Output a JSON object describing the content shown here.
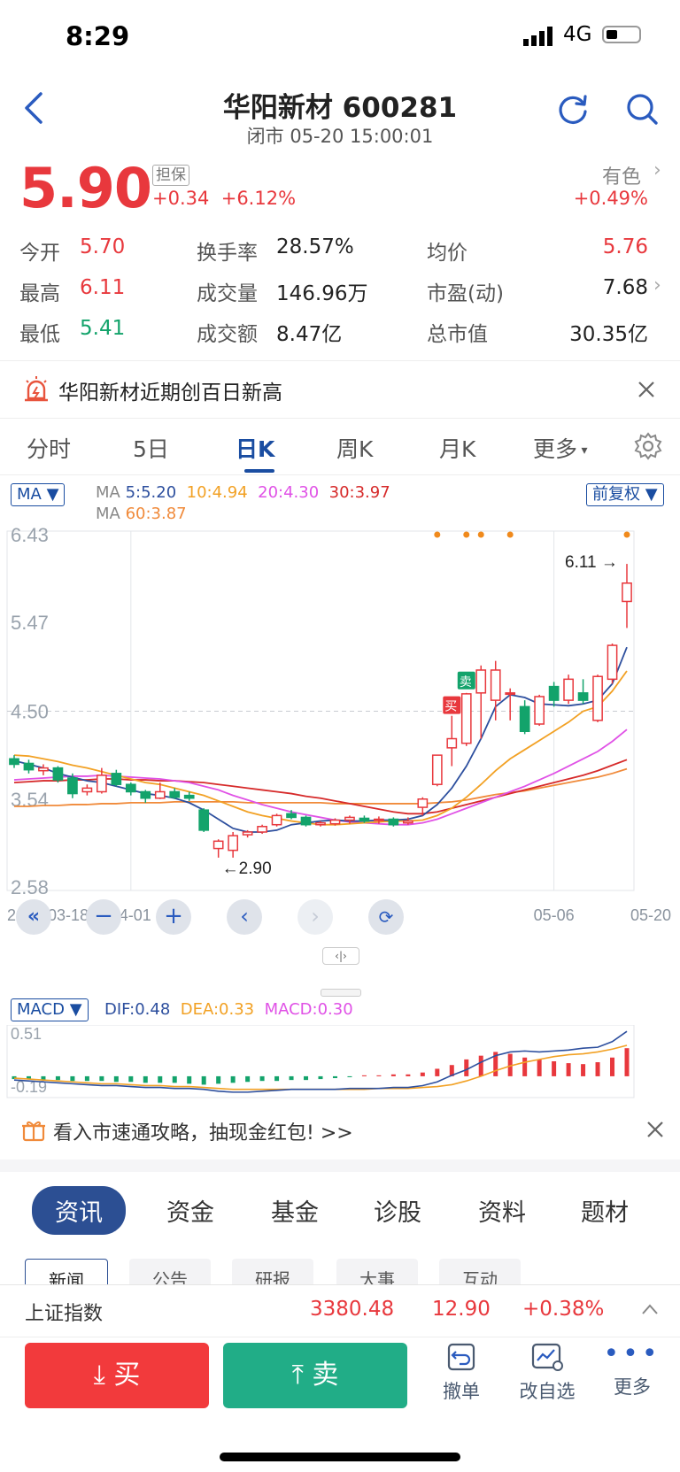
{
  "status_bar": {
    "time": "8:29",
    "network": "4G"
  },
  "header": {
    "title": "华阳新材 600281",
    "subtitle": "闭市 05-20 15:00:01"
  },
  "quote": {
    "price": "5.90",
    "tag": "担保",
    "change": "+0.34",
    "change_pct": "+6.12%",
    "sector": "有色",
    "sector_pct": "+0.49%"
  },
  "stats": [
    {
      "label": "今开",
      "value": "5.70",
      "color": "#e8383d"
    },
    {
      "label": "换手率",
      "value": "28.57%",
      "color": "#222222"
    },
    {
      "label": "均价",
      "value": "5.76",
      "color": "#e8383d"
    },
    {
      "label": "最高",
      "value": "6.11",
      "color": "#e8383d"
    },
    {
      "label": "成交量",
      "value": "146.96万",
      "color": "#222222"
    },
    {
      "label": "市盈(动)",
      "value": "7.68",
      "color": "#222222"
    },
    {
      "label": "最低",
      "value": "5.41",
      "color": "#13a36b"
    },
    {
      "label": "成交额",
      "value": "8.47亿",
      "color": "#222222"
    },
    {
      "label": "总市值",
      "value": "30.35亿",
      "color": "#222222"
    }
  ],
  "notice": {
    "text": "华阳新材近期创百日新高"
  },
  "kline_tabs": [
    "分时",
    "5日",
    "日K",
    "周K",
    "月K",
    "更多"
  ],
  "kline_active": "日K",
  "ma_legend": {
    "selector": "MA",
    "prefix": "MA",
    "ma5": "5:5.20",
    "ma10": "10:4.94",
    "ma20": "20:4.30",
    "ma30": "30:3.97",
    "ma60": "60:3.87",
    "adjust": "前复权"
  },
  "colors": {
    "ma5": "#2d4f9e",
    "ma10": "#f2a124",
    "ma20": "#e052e6",
    "ma30": "#d62a2a",
    "ma60": "#f08a3a",
    "up": "#e8383d",
    "down": "#13a36b"
  },
  "chart_data": {
    "type": "candlestick",
    "y_ticks": [
      "6.43",
      "5.47",
      "4.50",
      "3.54",
      "2.58"
    ],
    "x_ticks": [
      "2025-03-18",
      "04-01",
      "05-06",
      "05-20"
    ],
    "ylim": [
      2.58,
      6.43
    ],
    "high_marker": "6.11",
    "low_marker": "2.90",
    "buy_label": "买",
    "sell_label": "卖",
    "candles": [
      {
        "o": 3.98,
        "h": 4.02,
        "l": 3.88,
        "c": 3.92
      },
      {
        "o": 3.93,
        "h": 3.97,
        "l": 3.82,
        "c": 3.86
      },
      {
        "o": 3.85,
        "h": 3.92,
        "l": 3.8,
        "c": 3.88
      },
      {
        "o": 3.88,
        "h": 3.9,
        "l": 3.72,
        "c": 3.75
      },
      {
        "o": 3.77,
        "h": 3.82,
        "l": 3.55,
        "c": 3.6
      },
      {
        "o": 3.62,
        "h": 3.7,
        "l": 3.58,
        "c": 3.66
      },
      {
        "o": 3.62,
        "h": 3.88,
        "l": 3.6,
        "c": 3.8
      },
      {
        "o": 3.82,
        "h": 3.86,
        "l": 3.68,
        "c": 3.7
      },
      {
        "o": 3.7,
        "h": 3.72,
        "l": 3.58,
        "c": 3.62
      },
      {
        "o": 3.62,
        "h": 3.64,
        "l": 3.5,
        "c": 3.55
      },
      {
        "o": 3.55,
        "h": 3.72,
        "l": 3.54,
        "c": 3.62
      },
      {
        "o": 3.62,
        "h": 3.66,
        "l": 3.54,
        "c": 3.56
      },
      {
        "o": 3.58,
        "h": 3.62,
        "l": 3.52,
        "c": 3.55
      },
      {
        "o": 3.42,
        "h": 3.44,
        "l": 3.18,
        "c": 3.2
      },
      {
        "o": 3.0,
        "h": 3.1,
        "l": 2.9,
        "c": 3.08
      },
      {
        "o": 2.98,
        "h": 3.18,
        "l": 2.9,
        "c": 3.14
      },
      {
        "o": 3.15,
        "h": 3.2,
        "l": 3.12,
        "c": 3.18
      },
      {
        "o": 3.18,
        "h": 3.26,
        "l": 3.16,
        "c": 3.24
      },
      {
        "o": 3.26,
        "h": 3.38,
        "l": 3.24,
        "c": 3.36
      },
      {
        "o": 3.38,
        "h": 3.42,
        "l": 3.32,
        "c": 3.34
      },
      {
        "o": 3.34,
        "h": 3.36,
        "l": 3.24,
        "c": 3.26
      },
      {
        "o": 3.26,
        "h": 3.3,
        "l": 3.24,
        "c": 3.28
      },
      {
        "o": 3.27,
        "h": 3.33,
        "l": 3.25,
        "c": 3.31
      },
      {
        "o": 3.31,
        "h": 3.36,
        "l": 3.27,
        "c": 3.34
      },
      {
        "o": 3.33,
        "h": 3.36,
        "l": 3.28,
        "c": 3.3
      },
      {
        "o": 3.31,
        "h": 3.35,
        "l": 3.27,
        "c": 3.32
      },
      {
        "o": 3.32,
        "h": 3.34,
        "l": 3.24,
        "c": 3.26
      },
      {
        "o": 3.28,
        "h": 3.34,
        "l": 3.26,
        "c": 3.3
      },
      {
        "o": 3.45,
        "h": 3.56,
        "l": 3.36,
        "c": 3.54
      },
      {
        "o": 3.7,
        "h": 4.02,
        "l": 3.68,
        "c": 4.02
      },
      {
        "o": 4.1,
        "h": 4.45,
        "l": 3.9,
        "c": 4.2
      },
      {
        "o": 4.15,
        "h": 4.7,
        "l": 4.12,
        "c": 4.69
      },
      {
        "o": 4.7,
        "h": 5.0,
        "l": 4.2,
        "c": 4.95
      },
      {
        "o": 4.62,
        "h": 5.05,
        "l": 4.4,
        "c": 4.95
      },
      {
        "o": 4.7,
        "h": 4.75,
        "l": 4.4,
        "c": 4.7
      },
      {
        "o": 4.55,
        "h": 4.62,
        "l": 4.25,
        "c": 4.28
      },
      {
        "o": 4.36,
        "h": 4.68,
        "l": 4.34,
        "c": 4.66
      },
      {
        "o": 4.77,
        "h": 4.82,
        "l": 4.55,
        "c": 4.62
      },
      {
        "o": 4.62,
        "h": 4.9,
        "l": 4.58,
        "c": 4.85
      },
      {
        "o": 4.7,
        "h": 4.85,
        "l": 4.58,
        "c": 4.62
      },
      {
        "o": 4.4,
        "h": 4.9,
        "l": 4.38,
        "c": 4.88
      },
      {
        "o": 4.85,
        "h": 5.24,
        "l": 4.8,
        "c": 5.22
      },
      {
        "o": 5.7,
        "h": 6.11,
        "l": 5.41,
        "c": 5.9
      }
    ],
    "ma5": [
      3.96,
      3.92,
      3.88,
      3.82,
      3.78,
      3.74,
      3.72,
      3.68,
      3.64,
      3.6,
      3.58,
      3.55,
      3.5,
      3.42,
      3.32,
      3.22,
      3.18,
      3.18,
      3.2,
      3.26,
      3.28,
      3.3,
      3.31,
      3.3,
      3.3,
      3.31,
      3.31,
      3.32,
      3.36,
      3.48,
      3.66,
      3.9,
      4.2,
      4.55,
      4.68,
      4.65,
      4.58,
      4.57,
      4.56,
      4.58,
      4.62,
      4.8,
      5.2
    ],
    "ma10": [
      4.02,
      4.01,
      3.98,
      3.95,
      3.91,
      3.88,
      3.84,
      3.8,
      3.76,
      3.72,
      3.7,
      3.66,
      3.62,
      3.58,
      3.52,
      3.46,
      3.4,
      3.36,
      3.33,
      3.3,
      3.28,
      3.26,
      3.26,
      3.27,
      3.28,
      3.29,
      3.3,
      3.3,
      3.31,
      3.36,
      3.44,
      3.56,
      3.7,
      3.85,
      3.98,
      4.08,
      4.18,
      4.28,
      4.38,
      4.5,
      4.55,
      4.72,
      4.94
    ],
    "ma20": [
      3.75,
      3.76,
      3.77,
      3.78,
      3.79,
      3.79,
      3.8,
      3.79,
      3.78,
      3.77,
      3.76,
      3.74,
      3.72,
      3.68,
      3.64,
      3.58,
      3.53,
      3.48,
      3.44,
      3.4,
      3.37,
      3.34,
      3.31,
      3.29,
      3.28,
      3.27,
      3.26,
      3.26,
      3.28,
      3.32,
      3.38,
      3.44,
      3.5,
      3.56,
      3.62,
      3.68,
      3.75,
      3.82,
      3.9,
      3.98,
      4.06,
      4.17,
      4.3
    ],
    "ma30": [
      3.72,
      3.73,
      3.74,
      3.74,
      3.75,
      3.75,
      3.76,
      3.76,
      3.75,
      3.75,
      3.74,
      3.74,
      3.73,
      3.72,
      3.7,
      3.68,
      3.66,
      3.64,
      3.62,
      3.6,
      3.57,
      3.55,
      3.52,
      3.49,
      3.46,
      3.43,
      3.4,
      3.38,
      3.38,
      3.4,
      3.44,
      3.48,
      3.52,
      3.56,
      3.6,
      3.64,
      3.68,
      3.72,
      3.76,
      3.8,
      3.85,
      3.91,
      3.97
    ],
    "ma60": [
      3.46,
      3.46,
      3.47,
      3.47,
      3.48,
      3.48,
      3.49,
      3.49,
      3.5,
      3.5,
      3.5,
      3.51,
      3.51,
      3.51,
      3.51,
      3.51,
      3.5,
      3.5,
      3.5,
      3.5,
      3.5,
      3.5,
      3.49,
      3.49,
      3.49,
      3.49,
      3.49,
      3.49,
      3.49,
      3.5,
      3.51,
      3.53,
      3.56,
      3.59,
      3.61,
      3.63,
      3.66,
      3.69,
      3.72,
      3.75,
      3.78,
      3.82,
      3.87
    ],
    "macd": {
      "selector": "MACD",
      "dif_text": "DIF:0.48",
      "dea_text": "DEA:0.33",
      "macd_text": "MACD:0.30",
      "y_ticks": [
        "0.51",
        "-0.19"
      ],
      "ylim": [
        -0.19,
        0.51
      ],
      "dif": [
        -0.04,
        -0.05,
        -0.06,
        -0.07,
        -0.08,
        -0.09,
        -0.1,
        -0.1,
        -0.11,
        -0.12,
        -0.12,
        -0.13,
        -0.13,
        -0.14,
        -0.16,
        -0.17,
        -0.17,
        -0.16,
        -0.15,
        -0.14,
        -0.14,
        -0.14,
        -0.14,
        -0.13,
        -0.13,
        -0.13,
        -0.12,
        -0.12,
        -0.1,
        -0.06,
        0.01,
        0.07,
        0.15,
        0.22,
        0.26,
        0.27,
        0.26,
        0.27,
        0.28,
        0.3,
        0.31,
        0.37,
        0.48
      ],
      "dea": [
        -0.02,
        -0.03,
        -0.04,
        -0.05,
        -0.06,
        -0.07,
        -0.08,
        -0.08,
        -0.09,
        -0.1,
        -0.1,
        -0.11,
        -0.11,
        -0.12,
        -0.13,
        -0.14,
        -0.14,
        -0.14,
        -0.14,
        -0.14,
        -0.14,
        -0.14,
        -0.14,
        -0.14,
        -0.14,
        -0.13,
        -0.13,
        -0.13,
        -0.12,
        -0.11,
        -0.09,
        -0.05,
        0.0,
        0.06,
        0.11,
        0.15,
        0.18,
        0.21,
        0.23,
        0.24,
        0.26,
        0.29,
        0.33
      ],
      "hist": [
        -0.03,
        -0.03,
        -0.04,
        -0.04,
        -0.05,
        -0.05,
        -0.05,
        -0.06,
        -0.06,
        -0.07,
        -0.07,
        -0.07,
        -0.08,
        -0.09,
        -0.08,
        -0.07,
        -0.06,
        -0.05,
        -0.05,
        -0.04,
        -0.04,
        -0.03,
        -0.02,
        -0.01,
        0.01,
        0.01,
        0.02,
        0.02,
        0.04,
        0.08,
        0.12,
        0.18,
        0.22,
        0.26,
        0.24,
        0.2,
        0.18,
        0.16,
        0.14,
        0.13,
        0.15,
        0.2,
        0.3
      ]
    }
  },
  "promo": {
    "text": "看入市速通攻略，抽现金红包! >>"
  },
  "bottom_tabs": [
    "资讯",
    "资金",
    "基金",
    "诊股",
    "资料",
    "题材"
  ],
  "sub_tabs": [
    "新闻",
    "公告",
    "研报",
    "大事",
    "互动"
  ],
  "index_bar": {
    "name": "上证指数",
    "value": "3380.48",
    "change": "12.90",
    "pct": "+0.38%"
  },
  "actions": {
    "buy": "买",
    "sell": "卖",
    "cancel": "撤单",
    "edit_watch": "改自选",
    "more": "更多"
  }
}
